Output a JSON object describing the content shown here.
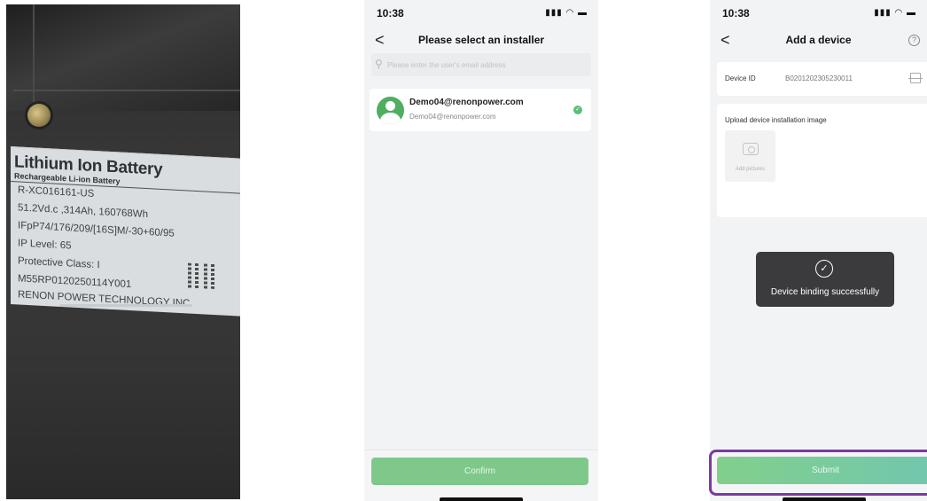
{
  "photo_label": {
    "title": "Lithium Ion Battery",
    "subtitle": "Rechargeable Li-ion Battery",
    "lines": [
      "R-XC016161-US",
      "51.2Vd.c ,314Ah, 160768Wh",
      "IFpP74/176/209/[16S]M/-30+60/95",
      "IP Level: 65",
      "Protective Class: I",
      "M55RP0120250114Y001",
      "RENON POWER TECHNOLOGY INC"
    ]
  },
  "screen1": {
    "status": {
      "time": "10:38",
      "icons": "▮▮▮ ◠ ▬"
    },
    "nav": {
      "back": "<",
      "title": "Please select an installer"
    },
    "search": {
      "placeholder": "Please enter the user's email address",
      "value": ""
    },
    "installer": {
      "name": "Demo04@renonpower.com",
      "email": "Demo04@renonpower.com",
      "selected": true
    },
    "confirm_label": "Confirm"
  },
  "screen2": {
    "status": {
      "time": "10:38",
      "icons": "▮▮▮ ◠ ▬"
    },
    "nav": {
      "back": "<",
      "title": "Add a device",
      "help": "?"
    },
    "device": {
      "label": "Device ID",
      "value": "B0201202305230011"
    },
    "upload": {
      "label": "Upload device installation image",
      "add_label": "Add pictures"
    },
    "toast": {
      "icon": "✓",
      "message": "Device binding successfully"
    },
    "submit_label": "Submit",
    "highlight_color": "#7b3aa0"
  }
}
